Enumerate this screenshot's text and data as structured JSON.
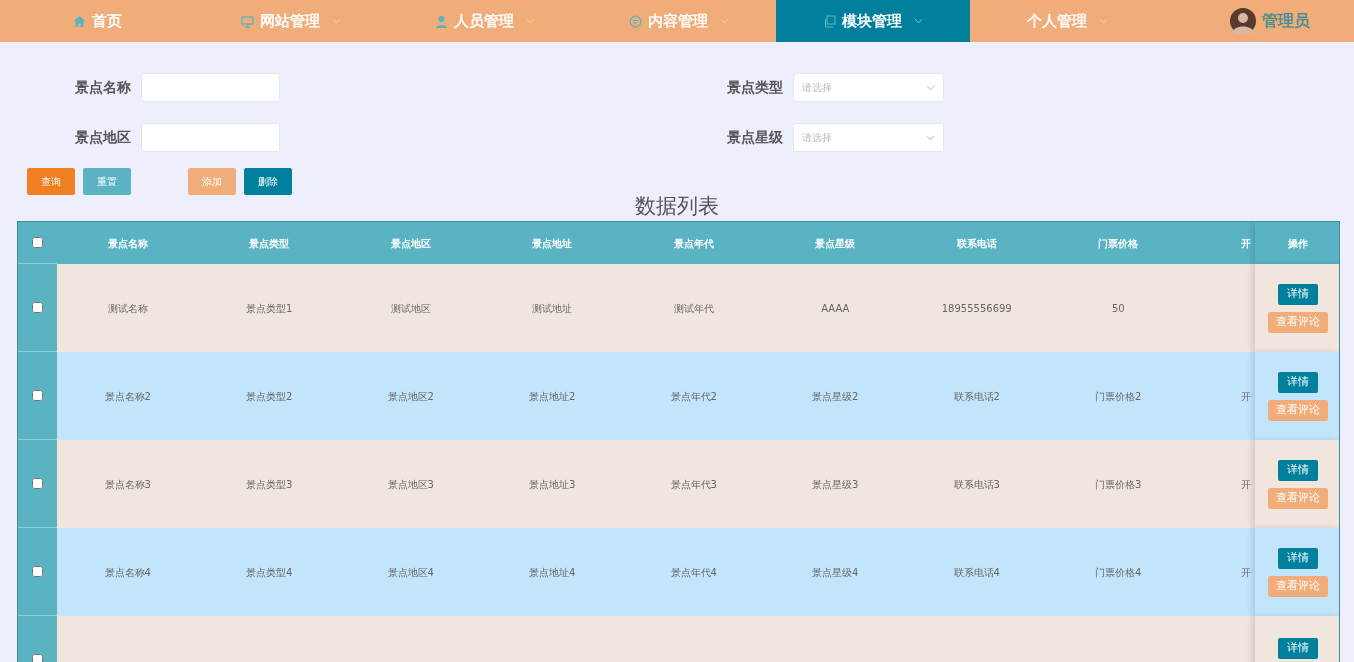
{
  "nav": {
    "items": [
      {
        "label": "首页",
        "kind": "home",
        "dropdown": false,
        "selected": false
      },
      {
        "label": "网站管理",
        "kind": "monitor",
        "dropdown": true,
        "selected": false
      },
      {
        "label": "人员管理",
        "kind": "person",
        "dropdown": true,
        "selected": false
      },
      {
        "label": "内容管理",
        "kind": "chat",
        "dropdown": true,
        "selected": false
      },
      {
        "label": "模块管理",
        "kind": "copy",
        "dropdown": true,
        "selected": true
      },
      {
        "label": "个人管理",
        "kind": "plain",
        "dropdown": true,
        "selected": false
      }
    ],
    "user": {
      "name": "管理员"
    }
  },
  "search": {
    "fields": [
      {
        "label": "景点名称",
        "kind": "input"
      },
      {
        "label": "景点类型",
        "kind": "select",
        "placeholder": "请选择"
      },
      {
        "label": "景点地区",
        "kind": "input"
      },
      {
        "label": "景点星级",
        "kind": "select",
        "placeholder": "请选择"
      }
    ],
    "buttons": [
      {
        "label": "查询",
        "kind": "search"
      },
      {
        "label": "重置",
        "kind": "reset"
      },
      {
        "label": "添加",
        "kind": "add"
      },
      {
        "label": "删除",
        "kind": "delete"
      }
    ]
  },
  "table": {
    "title": "数据列表",
    "select_all": {
      "checked": false
    },
    "columns": [
      "景点名称",
      "景点类型",
      "景点地区",
      "景点地址",
      "景点年代",
      "景点星级",
      "联系电话",
      "门票价格",
      "开",
      "操作"
    ],
    "rows": [
      {
        "checked": false,
        "cells": [
          "测试名称",
          "景点类型1",
          "测试地区",
          "测试地址",
          "测试年代",
          "AAAA",
          "18955556699",
          "50",
          null
        ],
        "actions": [
          "详情",
          "查看评论"
        ]
      },
      {
        "checked": false,
        "cells": [
          "景点名称2",
          "景点类型2",
          "景点地区2",
          "景点地址2",
          "景点年代2",
          "景点星级2",
          "联系电话2",
          "门票价格2",
          "开"
        ],
        "actions": [
          "详情",
          "查看评论"
        ]
      },
      {
        "checked": false,
        "cells": [
          "景点名称3",
          "景点类型3",
          "景点地区3",
          "景点地址3",
          "景点年代3",
          "景点星级3",
          "联系电话3",
          "门票价格3",
          "开"
        ],
        "actions": [
          "详情",
          "查看评论"
        ]
      },
      {
        "checked": false,
        "cells": [
          "景点名称4",
          "景点类型4",
          "景点地区4",
          "景点地址4",
          "景点年代4",
          "景点星级4",
          "联系电话4",
          "门票价格4",
          "开"
        ],
        "actions": [
          "详情",
          "查看评论"
        ]
      },
      {
        "checked": false,
        "cells": [
          null,
          null,
          null,
          null,
          null,
          null,
          null,
          null,
          null
        ],
        "actions": [
          "详情"
        ]
      }
    ]
  }
}
